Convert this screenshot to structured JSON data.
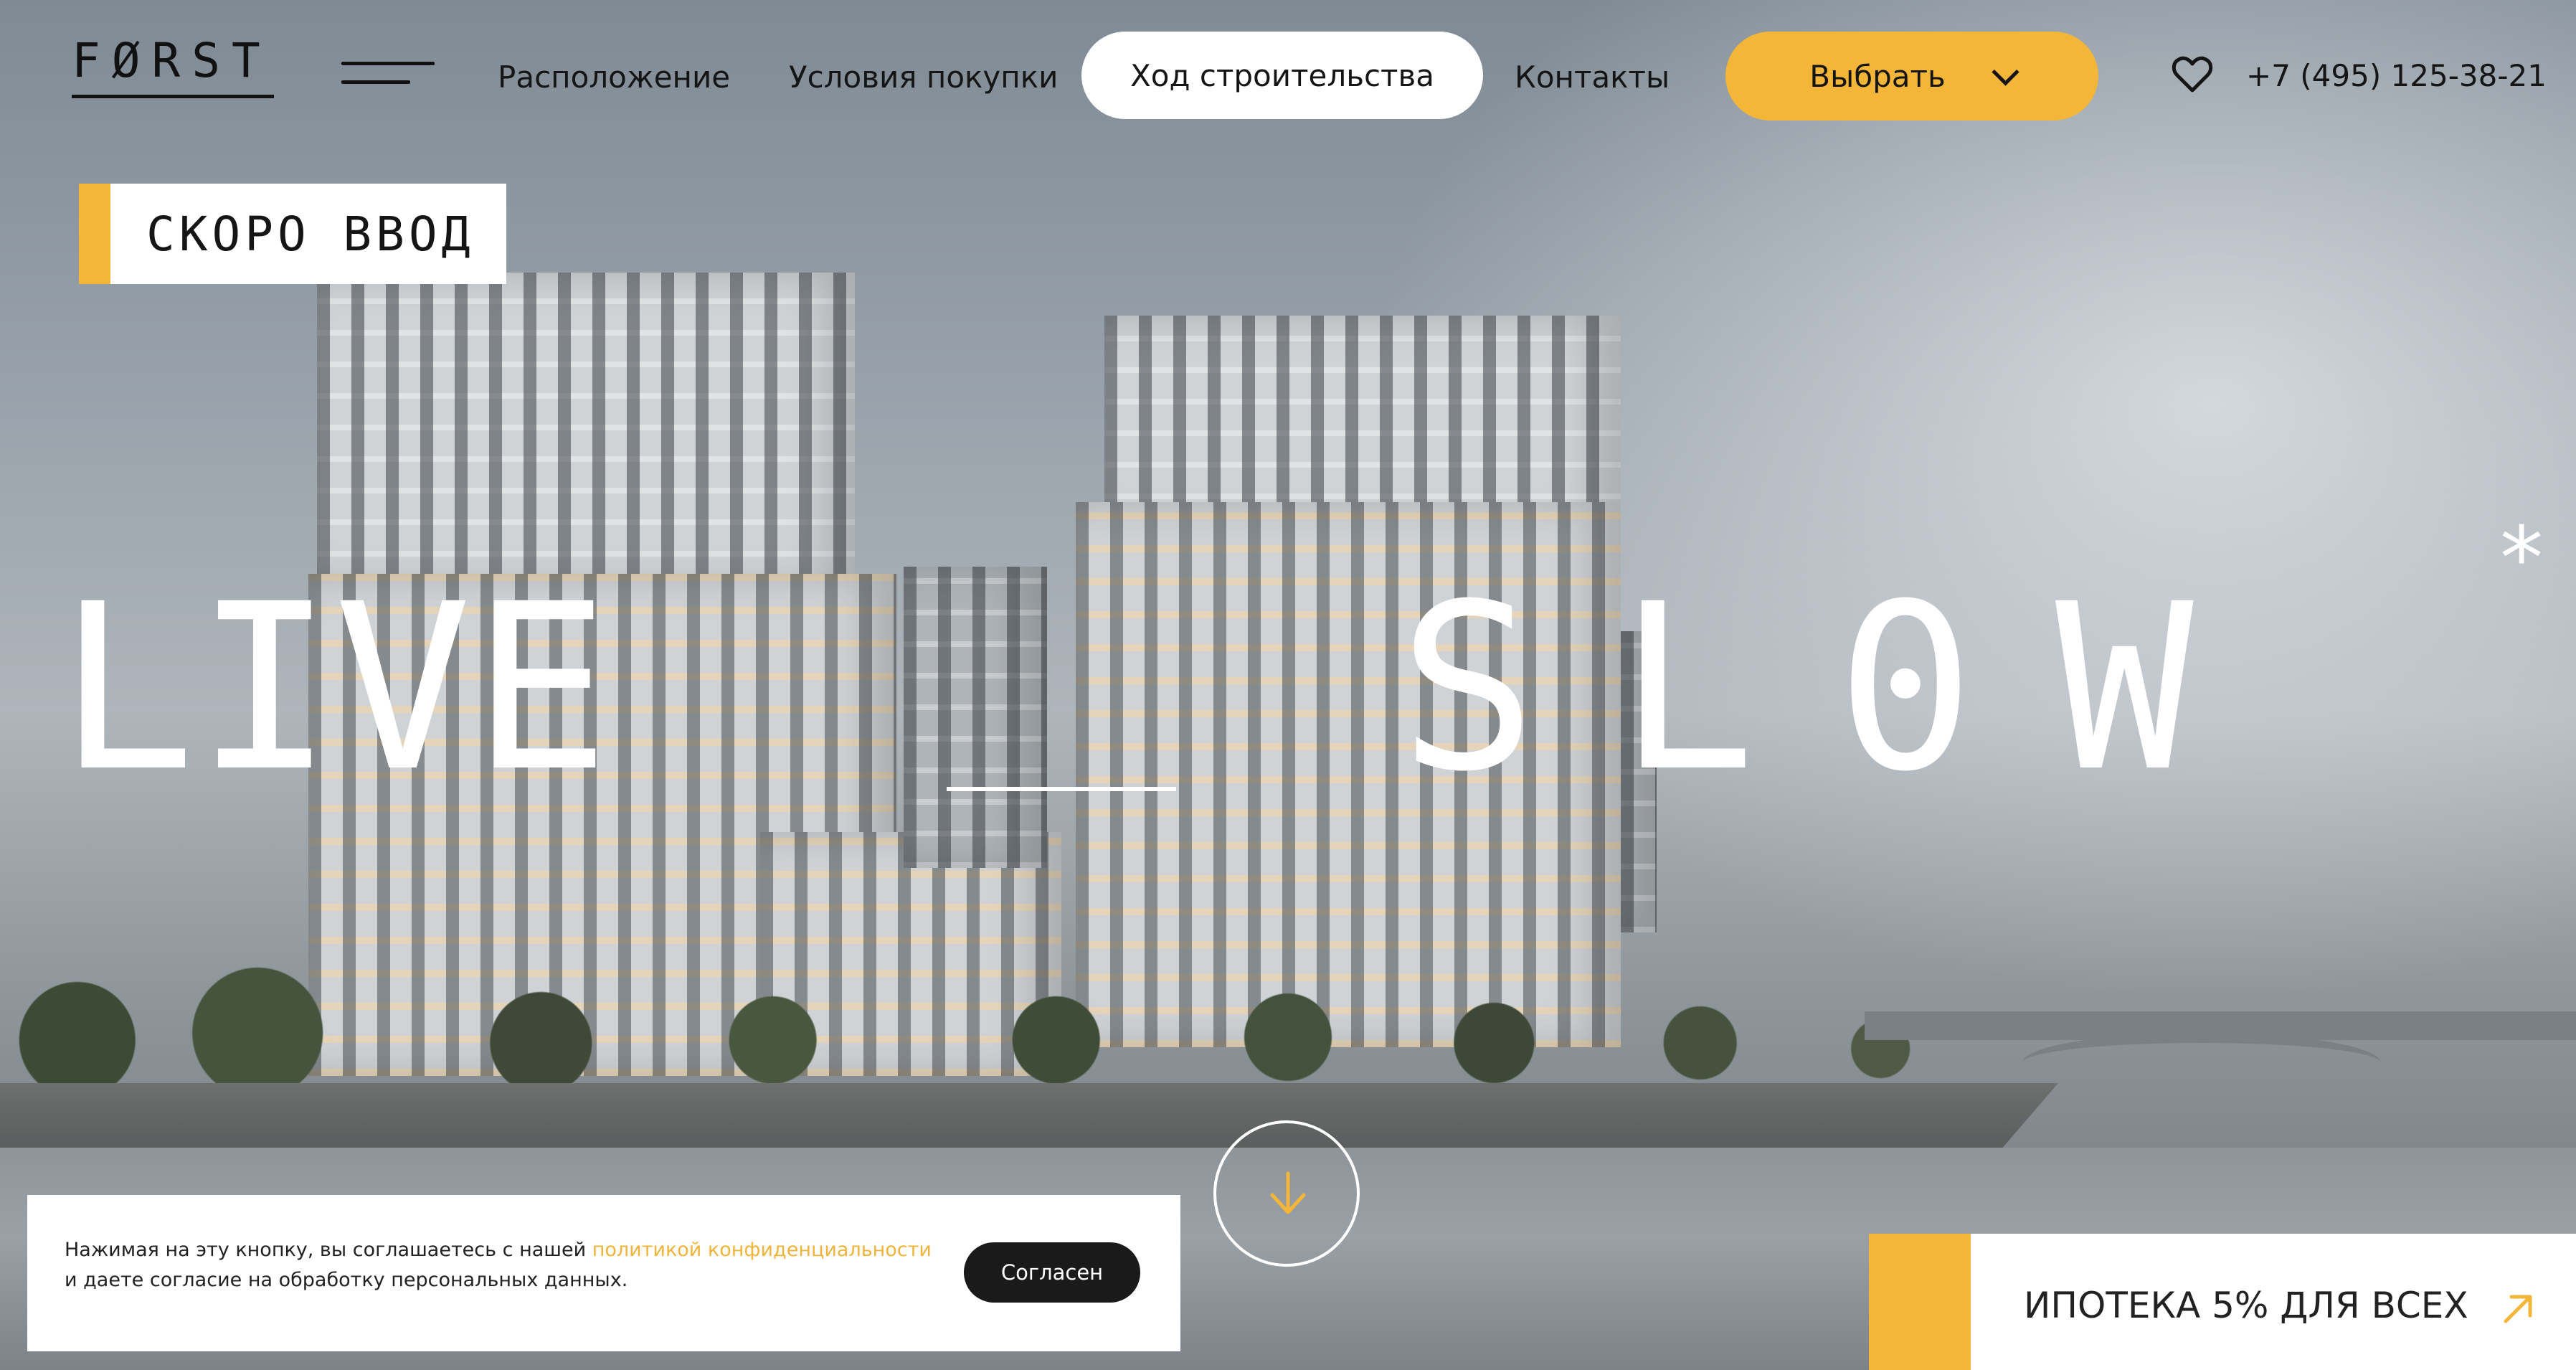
{
  "brand": {
    "logo": "FØRST"
  },
  "nav": {
    "items": [
      "Расположение",
      "Условия покупки",
      "Ход строительства",
      "Контакты"
    ],
    "choose_label": "Выбрать",
    "phone": "+7 (495) 125-38-21"
  },
  "hero": {
    "badge": "СКОРО ВВОД",
    "title_left": "LIVE",
    "title_right": "S L 0 W",
    "asterisk": "*"
  },
  "cookie": {
    "text_before": "Нажимая на эту кнопку, вы соглашаетесь с нашей ",
    "link": "политикой конфиденциальности",
    "text_after": "и даете согласие на обработку персональных данных.",
    "button": "Согласен"
  },
  "promo": {
    "label": "ИПОТЕКА 5% ДЛЯ ВСЕХ"
  },
  "colors": {
    "accent": "#f3b638",
    "text": "#151515",
    "white": "#ffffff"
  },
  "icons": {
    "menu": "menu-icon",
    "heart": "heart-icon",
    "chevron": "chevron-down-icon",
    "scroll": "arrow-down-icon",
    "promo": "arrow-up-right-icon"
  }
}
